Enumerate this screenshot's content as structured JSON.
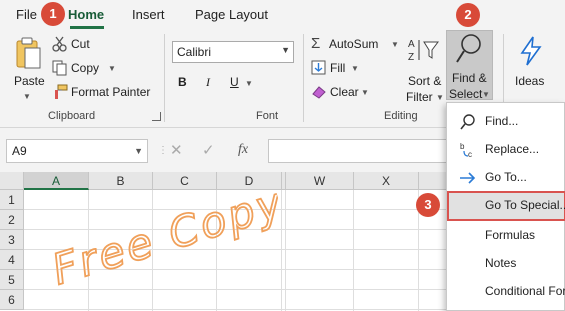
{
  "tabs": {
    "file": "File",
    "home": "Home",
    "insert": "Insert",
    "page_layout": "Page Layout"
  },
  "clipboard": {
    "paste": "Paste",
    "cut": "Cut",
    "copy": "Copy",
    "format_painter": "Format Painter",
    "group_label": "Clipboard"
  },
  "font": {
    "name": "Calibri",
    "bold": "B",
    "italic": "I",
    "underline": "U",
    "group_label": "Font"
  },
  "editing": {
    "autosum": "AutoSum",
    "fill": "Fill",
    "clear": "Clear",
    "sort_filter_line1": "Sort &",
    "sort_filter_line2": "Filter",
    "find_select_line1": "Find &",
    "find_select_line2": "Select",
    "group_label": "Editing"
  },
  "ideas": {
    "label": "Ideas"
  },
  "formula_bar": {
    "name_box": "A9",
    "fx": "fx"
  },
  "grid": {
    "columns": [
      "A",
      "B",
      "C",
      "D",
      "W",
      "X"
    ],
    "rows": [
      "1",
      "2",
      "3",
      "4",
      "5",
      "6"
    ],
    "selected_column": "A"
  },
  "menu": {
    "items": [
      "Find...",
      "Replace...",
      "Go To...",
      "Go To Special...",
      "Formulas",
      "Notes",
      "Conditional For"
    ]
  },
  "callouts": [
    "1",
    "2",
    "3"
  ],
  "watermark": "Free Copy",
  "colors": {
    "accent": "#217346",
    "callout": "#d84a38",
    "watermark": "#f0a05a"
  }
}
